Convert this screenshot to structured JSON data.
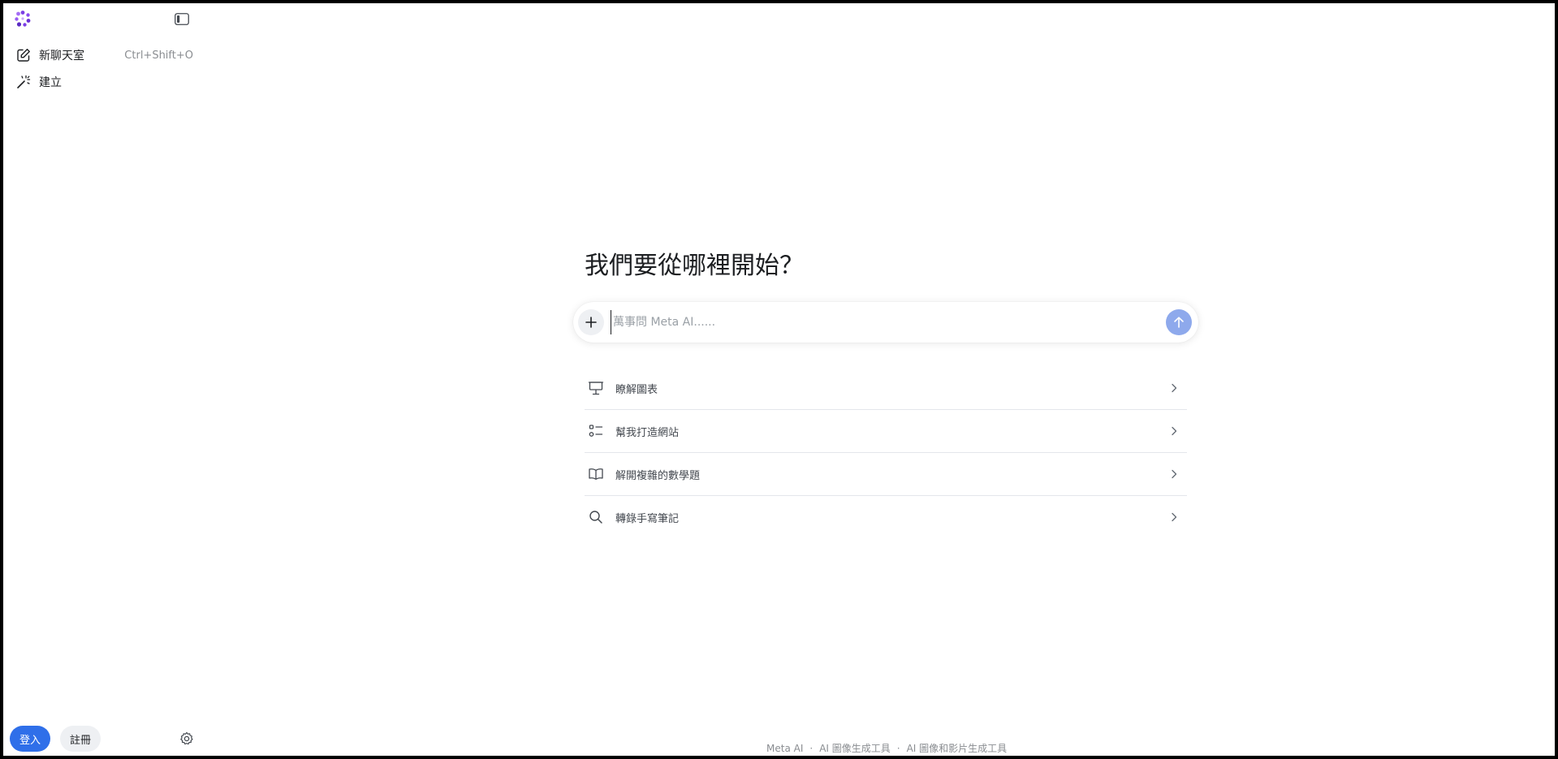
{
  "sidebar": {
    "logo_icon": "meta-ai-logo",
    "collapse_icon": "sidebar-toggle-icon",
    "items": [
      {
        "label": "新聊天室",
        "shortcut": "Ctrl+Shift+O",
        "icon": "edit-icon"
      },
      {
        "label": "建立",
        "icon": "magic-wand-icon"
      }
    ],
    "login_label": "登入",
    "signup_label": "註冊",
    "settings_icon": "gear-icon"
  },
  "main": {
    "headline": "我們要從哪裡開始？",
    "composer": {
      "placeholder": "萬事問 Meta AI......",
      "plus_icon": "plus-icon",
      "send_icon": "arrow-up-icon"
    },
    "suggestions": [
      {
        "label": "瞭解圖表",
        "icon": "presentation-icon"
      },
      {
        "label": "幫我打造網站",
        "icon": "checklist-icon"
      },
      {
        "label": "解開複雜的數學題",
        "icon": "book-icon"
      },
      {
        "label": "轉錄手寫筆記",
        "icon": "search-icon"
      }
    ]
  },
  "footer": {
    "links": [
      "Meta AI",
      "AI 圖像生成工具",
      "AI 圖像和影片生成工具"
    ],
    "separator": "·"
  },
  "colors": {
    "accent": "#2f6fe9",
    "send_button": "#8ea9ec",
    "logo_purple": "#7b3fe4"
  }
}
